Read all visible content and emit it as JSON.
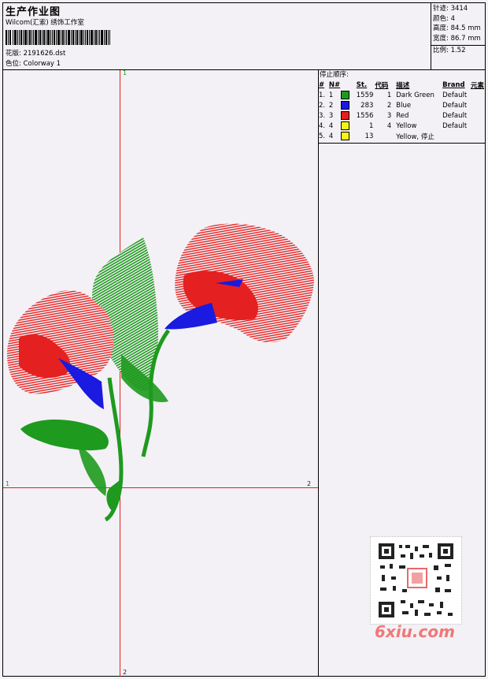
{
  "header": {
    "title": "生产作业图",
    "studio": "Wilcom(汇索) 绣饰工作室",
    "design_label": "花版:",
    "design_file": "2191626.dst",
    "colorway_label": "色位:",
    "colorway": "Colorway 1"
  },
  "stats": {
    "stitches": "针迹: 3414",
    "colors": "颜色: 4",
    "height": "高度: 84.5 mm",
    "width": "宽度: 86.7 mm",
    "scale": "比例: 1.52"
  },
  "stop_sequence": {
    "title": "停止顺序:",
    "headers": [
      "#",
      "N#",
      "St.",
      "代码",
      "描述",
      "Brand",
      "元素"
    ],
    "rows": [
      {
        "idx": "1.",
        "n": "1",
        "color": "#1e9a1e",
        "st": "1559",
        "code": "1",
        "desc": "Dark Green",
        "brand": "Default"
      },
      {
        "idx": "2.",
        "n": "2",
        "color": "#1a1ae0",
        "st": "283",
        "code": "2",
        "desc": "Blue",
        "brand": "Default"
      },
      {
        "idx": "3.",
        "n": "3",
        "color": "#e51e1e",
        "st": "1556",
        "code": "3",
        "desc": "Red",
        "brand": "Default"
      },
      {
        "idx": "4.",
        "n": "4",
        "color": "#f5f51a",
        "st": "1",
        "code": "4",
        "desc": "Yellow",
        "brand": "Default"
      },
      {
        "idx": "5.",
        "n": "4",
        "color": "#f5f51a",
        "st": "13",
        "code": "",
        "desc": "Yellow, 停止",
        "brand": ""
      }
    ]
  },
  "axes": {
    "top_label": "1",
    "bottom_label": "2",
    "left_label": "1",
    "right_label": "2"
  },
  "watermark": {
    "text": "6xiu.com"
  }
}
